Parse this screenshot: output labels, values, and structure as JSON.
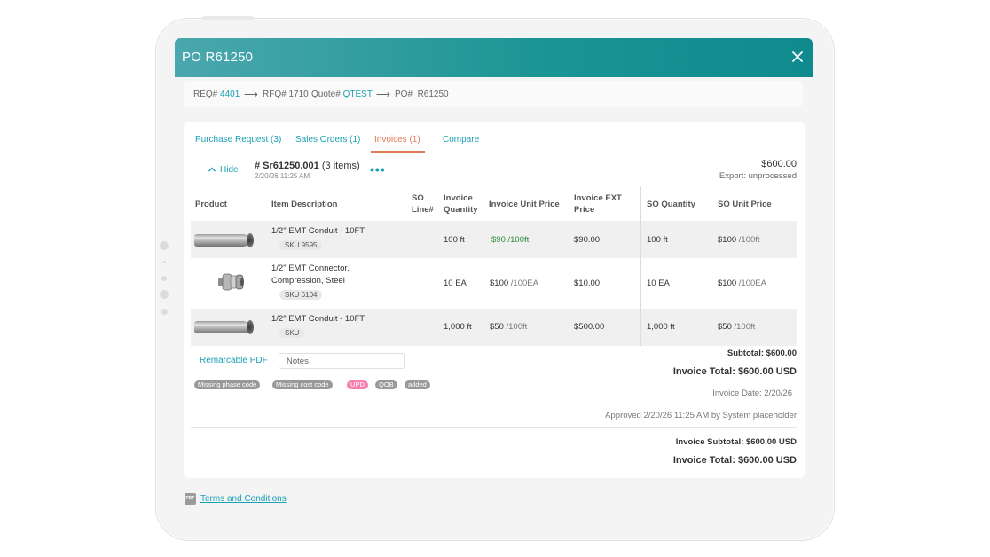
{
  "window": {
    "title": "PO R61250"
  },
  "breadcrumb": {
    "req_label": "REQ#",
    "req_value": "4401",
    "rfq_label": "RFQ#",
    "rfq_value": "1710",
    "quote_label": "Quote#",
    "quote_value": "QTEST",
    "po_label": "PO#",
    "po_value": "R61250",
    "arrow": "⟶"
  },
  "tabs": [
    {
      "label": "Purchase Request (3)"
    },
    {
      "label": "Sales Orders (1)"
    },
    {
      "label": "Invoices (1)"
    },
    {
      "label": "Compare"
    }
  ],
  "invoice": {
    "hide_label": "Hide",
    "number": "# Sr61250.001",
    "items": "(3 items)",
    "date": "2/20/26 11:25 AM",
    "more": "•••",
    "amount": "$600.00",
    "export": "Export:  unprocessed"
  },
  "table": {
    "headers": {
      "product": "Product",
      "description": "Item Description",
      "so_line_1": "SO",
      "so_line_2": "Line#",
      "inv_qty_1": "Invoice",
      "inv_qty_2": "Quantity",
      "inv_unit_price": "Invoice Unit Price",
      "inv_ext_1": "Invoice EXT",
      "inv_ext_2": "Price",
      "so_qty": "SO Quantity",
      "so_unit_price": "SO Unit Price"
    },
    "rows": [
      {
        "desc_1": "1/2\" EMT Conduit - 10FT",
        "desc_2": "",
        "sku": "SKU 9595",
        "inv_qty": "100 ft",
        "inv_price": "$90",
        "inv_price_unit": "/100ft",
        "ext": "$90.00",
        "so_qty": "100 ft",
        "so_price": "$100",
        "so_price_unit": "/100ft",
        "image": "conduit-pipe"
      },
      {
        "desc_1": "1/2\" EMT Connector,",
        "desc_2": "Compression, Steel",
        "sku": "SKU 6104",
        "inv_qty": "10 EA",
        "inv_price": "$100",
        "inv_price_unit": "/100EA",
        "ext": "$10.00",
        "so_qty": "10 EA",
        "so_price": "$100",
        "so_price_unit": "/100EA",
        "image": "emt-connector"
      },
      {
        "desc_1": "1/2\" EMT Conduit - 10FT",
        "desc_2": "",
        "sku": "SKU",
        "inv_qty": "1,000 ft",
        "inv_price": "$50",
        "inv_price_unit": "/100ft",
        "ext": "$500.00",
        "so_qty": "1,000 ft",
        "so_price": "$50",
        "so_price_unit": "/100ft",
        "image": "conduit-pipe"
      }
    ]
  },
  "footer": {
    "remarcable_pdf": "Remarcable PDF",
    "notes_placeholder": "Notes",
    "tags": [
      "Missing phase code",
      "Missing cost code",
      "UPD",
      "QOB",
      "added"
    ],
    "subtotal": "Subtotal: $600.00",
    "invoice_total": "Invoice Total: $600.00 USD",
    "invoice_date": "Invoice Date: 2/20/26",
    "approved": "Approved 2/20/26 11:25 AM by System placeholder",
    "grand_subtotal": "Invoice Subtotal: $600.00 USD",
    "grand_total": "Invoice Total: $600.00 USD"
  },
  "terms": {
    "label": "Terms and Conditions",
    "icon_text": "PDF"
  },
  "colors": {
    "accent": "#1aa0b4",
    "header": "#1a9494",
    "active_tab": "#e27a55",
    "tag_pink": "#f57fb0",
    "tag_gray": "#999999"
  }
}
